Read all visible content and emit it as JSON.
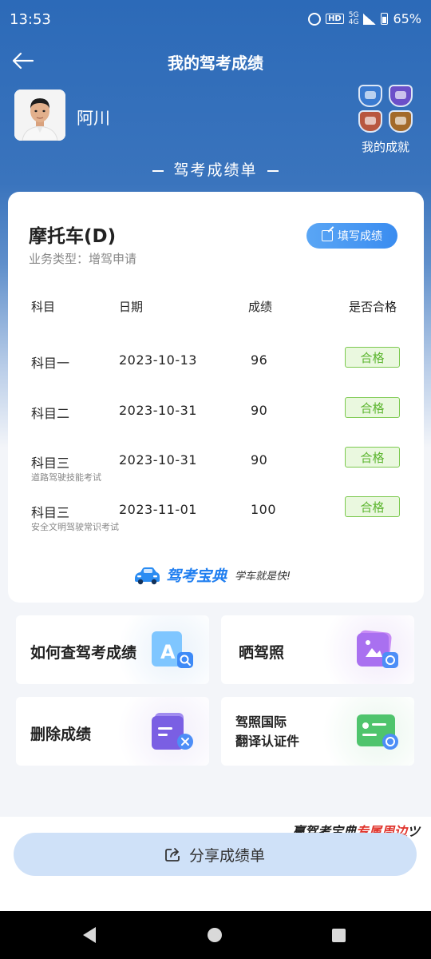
{
  "status_bar": {
    "time": "13:53",
    "battery": "65%",
    "network_top": "5G",
    "network_bottom": "4G",
    "hd": "HD"
  },
  "nav": {
    "title": "我的驾考成绩"
  },
  "profile": {
    "name": "阿川",
    "achievement_label": "我的成就"
  },
  "sheet_title": "驾考成绩单",
  "card": {
    "license_type": "摩托车(D)",
    "business_type": "业务类型：增驾申请",
    "fill_button": "填写成绩",
    "headers": {
      "subject": "科目",
      "date": "日期",
      "score": "成绩",
      "passed": "是否合格"
    },
    "rows": [
      {
        "subject": "科目一",
        "sub": "",
        "date": "2023-10-13",
        "score": "96",
        "status": "合格"
      },
      {
        "subject": "科目二",
        "sub": "",
        "date": "2023-10-31",
        "score": "90",
        "status": "合格"
      },
      {
        "subject": "科目三",
        "sub": "道路驾驶技能考试",
        "date": "2023-10-31",
        "score": "90",
        "status": "合格"
      },
      {
        "subject": "科目三",
        "sub": "安全文明驾驶常识考试",
        "date": "2023-11-01",
        "score": "100",
        "status": "合格"
      }
    ],
    "brand_name": "驾考宝典",
    "brand_slogan": "学车就是快!"
  },
  "tiles": [
    {
      "label": "如何查驾考成绩",
      "icon": "search-score-icon"
    },
    {
      "label": "晒驾照",
      "icon": "photo-camera-icon"
    },
    {
      "label": "删除成绩",
      "icon": "delete-doc-icon"
    },
    {
      "label_line1": "驾照国际",
      "label_line2": "翻译认证件",
      "icon": "license-card-icon"
    }
  ],
  "promo": {
    "prefix": "赢驾考宝典",
    "highlight": "专属周边",
    "suffix": "ツ"
  },
  "share_button": "分享成绩单",
  "colors": {
    "primary_blue": "#2c6ab8",
    "pass_green": "#5bb52e",
    "button_blue": "#3a8cf0"
  }
}
